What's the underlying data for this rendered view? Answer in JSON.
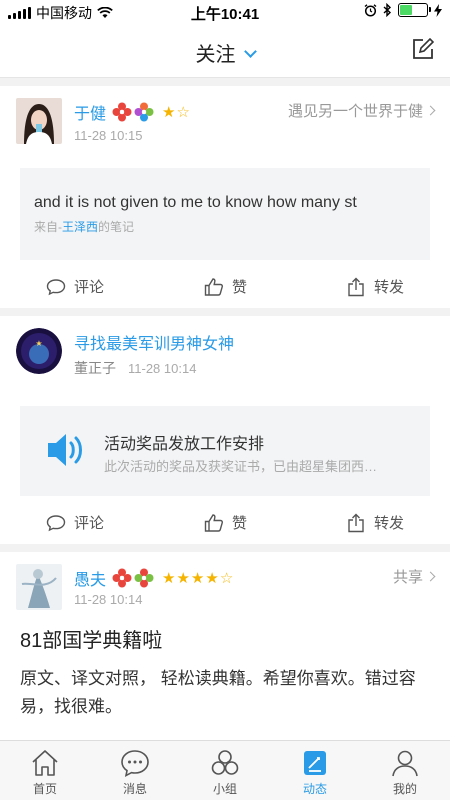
{
  "status_bar": {
    "carrier": "中国移动",
    "time": "上午10:41"
  },
  "nav": {
    "title": "关注"
  },
  "posts": [
    {
      "author": "于健",
      "time": "11-28 10:15",
      "right_text": "遇见另一个世界于健",
      "rating": {
        "filled": 1,
        "total": 2
      },
      "quote": {
        "text": "and it is not given to me to know how many st",
        "source_prefix": "来自-",
        "source_name": "王泽西",
        "source_suffix": "的笔记"
      }
    },
    {
      "author": "寻找最美军训男神女神",
      "sub_author": "董正子",
      "time": "11-28 10:14",
      "audio": {
        "title": "活动奖品发放工作安排",
        "desc": "此次活动的奖品及获奖证书，已由超星集团西…"
      }
    },
    {
      "author": "愚夫",
      "time": "11-28 10:14",
      "right_text": "共享",
      "rating": {
        "filled": 4,
        "total": 5
      },
      "title": "81部国学典籍啦",
      "body": "原文、译文对照， 轻松读典籍。希望你喜欢。错过容易，找很难。"
    }
  ],
  "actions": {
    "comment": "评论",
    "like": "赞",
    "share": "转发"
  },
  "tabs": [
    {
      "label": "首页",
      "icon": "home-icon"
    },
    {
      "label": "消息",
      "icon": "message-icon"
    },
    {
      "label": "小组",
      "icon": "group-icon"
    },
    {
      "label": "动态",
      "icon": "feed-icon",
      "active": true
    },
    {
      "label": "我的",
      "icon": "profile-icon"
    }
  ],
  "colors": {
    "accent": "#2a9be6",
    "star": "#f5b400",
    "battery": "#4cd964"
  }
}
